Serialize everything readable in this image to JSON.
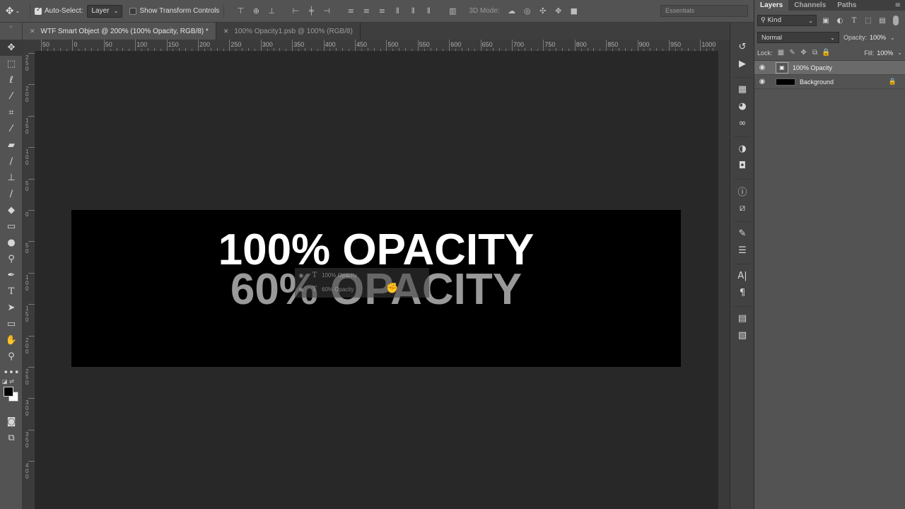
{
  "options_bar": {
    "auto_select_label": "Auto-Select:",
    "auto_select_checked": true,
    "target_value": "Layer",
    "transform_controls_label": "Show Transform Controls",
    "mode_3d_label": "3D Mode:",
    "workspace": "Essentials"
  },
  "tabs": [
    {
      "label": "WTF Smart Object @ 200% (100% Opacity, RGB/8) *",
      "active": true
    },
    {
      "label": "100% Opacity1.psb @ 100% (RGB/8)",
      "active": false
    }
  ],
  "ruler": {
    "h_labels": [
      "50",
      "0",
      "50",
      "100",
      "150",
      "200",
      "250",
      "300",
      "350",
      "400",
      "450",
      "500",
      "550",
      "600",
      "650",
      "700",
      "750",
      "800",
      "850",
      "900",
      "950",
      "1000"
    ],
    "v_labels": [
      "2 5 0",
      "2 0 0",
      "1 5 0",
      "1 0 0",
      "5 0",
      "0",
      "5 0",
      "1 0 0",
      "1 5 0",
      "2 0 0",
      "2 5 0",
      "3 0 0",
      "3 5 0",
      "4 0 0"
    ]
  },
  "canvas": {
    "text_100": "100% OPACITY",
    "text_60": "60% OPACITY",
    "ghost_layers": [
      "100% Opacity",
      "60% Opacity"
    ]
  },
  "layers_panel": {
    "tabs": [
      "Layers",
      "Channels",
      "Paths"
    ],
    "filter_kind": "Kind",
    "blend_mode": "Normal",
    "opacity_label": "Opacity:",
    "opacity_value": "100%",
    "lock_label": "Lock:",
    "fill_label": "Fill:",
    "fill_value": "100%",
    "layers": [
      {
        "name": "100% Opacity",
        "selected": true,
        "type": "smart-object"
      },
      {
        "name": "Background",
        "selected": false,
        "type": "background",
        "locked": true
      }
    ]
  }
}
